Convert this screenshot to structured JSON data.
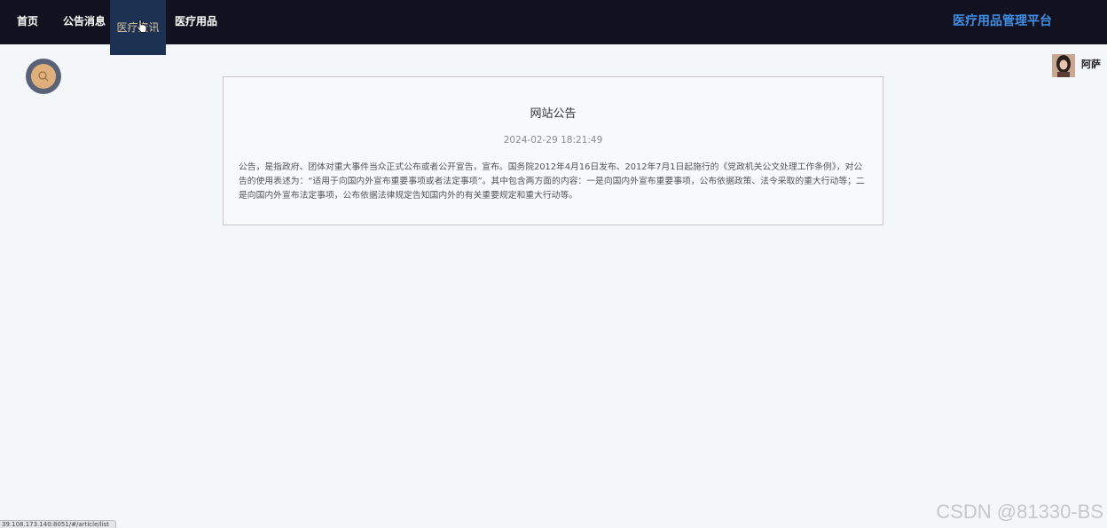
{
  "nav": {
    "items": [
      {
        "label": "首页"
      },
      {
        "label": "公告消息"
      },
      {
        "label": "医疗资讯"
      },
      {
        "label": "医疗用品"
      }
    ],
    "brand": "医疗用品管理平台"
  },
  "search": {
    "icon": "search-icon"
  },
  "user": {
    "name": "阿萨"
  },
  "article": {
    "title": "网站公告",
    "date": "2024-02-29 18:21:49",
    "body": "公告，是指政府、团体对重大事件当众正式公布或者公开宣告，宣布。国务院2012年4月16日发布、2012年7月1日起施行的《党政机关公文处理工作条例》，对公告的使用表述为：“适用于向国内外宣布重要事项或者法定事项”。其中包含两方面的内容：一是向国内外宣布重要事项，公布依据政策、法令采取的重大行动等；二是向国内外宣布法定事项，公布依据法律规定告知国内外的有关重要规定和重大行动等。"
  },
  "statusbar": {
    "url": "39.108.173.140:8051/#/article/list"
  },
  "watermark": "CSDN @81330-BS",
  "colors": {
    "topbar": "#12111f",
    "active_nav": "#1d3152",
    "brand": "#3f8fe6",
    "page_bg": "#f3f7f9"
  }
}
